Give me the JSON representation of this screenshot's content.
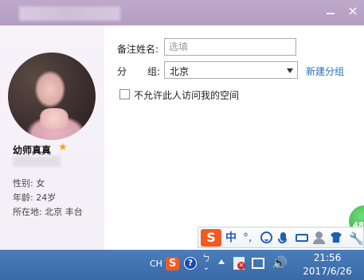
{
  "window": {
    "title": "███████",
    "minimize_glyph": "",
    "close_glyph": "×"
  },
  "profile": {
    "nickname": "幼师真真",
    "vip_icon": "star-icon",
    "account": "██████",
    "gender": "性别: 女",
    "age": "年龄: 24岁",
    "location": "所在地: 北京  丰台"
  },
  "form": {
    "remark_label": "备注姓名:",
    "remark_placeholder": "选填",
    "remark_value": "",
    "group_label_1": "分",
    "group_label_2": "组:",
    "group_value": "北京",
    "new_group_link": "新建分组",
    "privacy_checked": false,
    "privacy_label": "不允许此人访问我的空间"
  },
  "badge": {
    "text": "48"
  },
  "ime": {
    "logo": "S",
    "lang": "中",
    "punct": "°,",
    "icons": [
      "smile-icon",
      "mic-icon",
      "keyboard-icon",
      "user-icon",
      "shirt-icon",
      "wrench-icon"
    ]
  },
  "taskbar": {
    "lang": "CH",
    "ime_indicator_top": "ㄅ",
    "ime_indicator_bottom": "⌄",
    "time": "21:56",
    "date": "2017/6/26"
  },
  "colors": {
    "titlebar": "#b7a1c5",
    "link": "#2a6fb7",
    "taskbar": "#4272b0",
    "sogou": "#f15a22"
  }
}
